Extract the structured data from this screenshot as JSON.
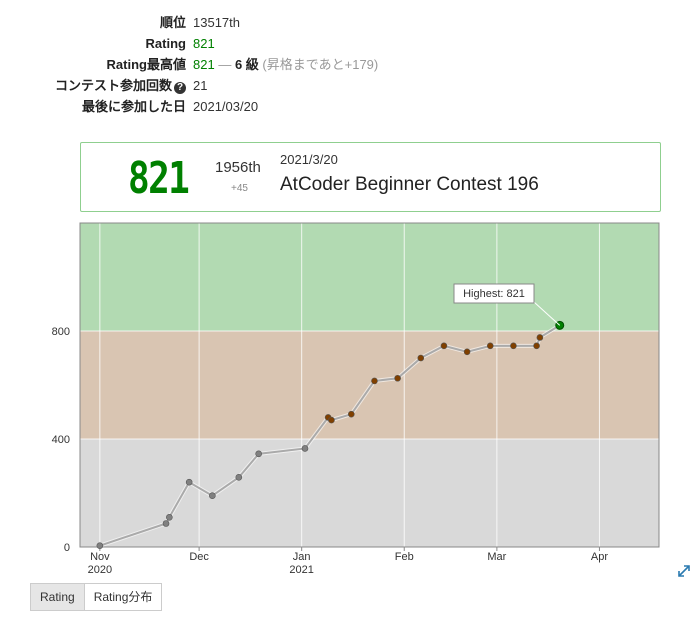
{
  "profile": {
    "rank_label": "順位",
    "rank_value": "13517th",
    "rating_label": "Rating",
    "rating_value": "821",
    "highest_label": "Rating最高値",
    "highest_value": "821",
    "highest_dash": "—",
    "highest_kyu": "6 級",
    "highest_note": "(昇格まであと+179)",
    "contests_label": "コンテスト参加回数",
    "contests_help_icon": "question-circle-icon",
    "contests_value": "21",
    "last_label": "最後に参加した日",
    "last_value": "2021/03/20"
  },
  "contest_card": {
    "rating": "821",
    "place": "1956th",
    "diff": "+45",
    "date": "2021/3/20",
    "name": "AtCoder Beginner Contest 196"
  },
  "tabs": {
    "rating": "Rating",
    "distribution": "Rating分布"
  },
  "expand_icon": "expand-arrows-icon",
  "chart_data": {
    "type": "line",
    "x_axis": {
      "type": "date",
      "range": [
        "2020-10-26",
        "2021-04-19"
      ],
      "ticks": [
        {
          "date": "2020-11-01",
          "label": "Nov",
          "sub": "2020"
        },
        {
          "date": "2020-12-01",
          "label": "Dec",
          "sub": ""
        },
        {
          "date": "2021-01-01",
          "label": "Jan",
          "sub": "2021"
        },
        {
          "date": "2021-02-01",
          "label": "Feb",
          "sub": ""
        },
        {
          "date": "2021-03-01",
          "label": "Mar",
          "sub": ""
        },
        {
          "date": "2021-04-01",
          "label": "Apr",
          "sub": ""
        }
      ]
    },
    "y_axis": {
      "range": [
        0,
        1200
      ],
      "ticks": [
        0,
        400,
        800
      ]
    },
    "bands": [
      {
        "from": 0,
        "to": 400,
        "color": "#d9d9d9"
      },
      {
        "from": 400,
        "to": 800,
        "color": "#d9c5b2"
      },
      {
        "from": 800,
        "to": 1200,
        "color": "#b2dab2"
      }
    ],
    "points": [
      {
        "date": "2020-11-01",
        "rating": 5
      },
      {
        "date": "2020-11-21",
        "rating": 87
      },
      {
        "date": "2020-11-22",
        "rating": 110
      },
      {
        "date": "2020-11-28",
        "rating": 240
      },
      {
        "date": "2020-12-05",
        "rating": 190
      },
      {
        "date": "2020-12-13",
        "rating": 258
      },
      {
        "date": "2020-12-19",
        "rating": 345
      },
      {
        "date": "2021-01-02",
        "rating": 365
      },
      {
        "date": "2021-01-09",
        "rating": 480
      },
      {
        "date": "2021-01-10",
        "rating": 470
      },
      {
        "date": "2021-01-16",
        "rating": 492
      },
      {
        "date": "2021-01-23",
        "rating": 615
      },
      {
        "date": "2021-01-30",
        "rating": 625
      },
      {
        "date": "2021-02-06",
        "rating": 700
      },
      {
        "date": "2021-02-13",
        "rating": 745
      },
      {
        "date": "2021-02-20",
        "rating": 723
      },
      {
        "date": "2021-02-27",
        "rating": 745
      },
      {
        "date": "2021-03-06",
        "rating": 745
      },
      {
        "date": "2021-03-13",
        "rating": 745
      },
      {
        "date": "2021-03-14",
        "rating": 776
      },
      {
        "date": "2021-03-20",
        "rating": 821
      }
    ],
    "highlight": {
      "label": "Highest: 821",
      "rating": 821
    },
    "grid": true
  }
}
